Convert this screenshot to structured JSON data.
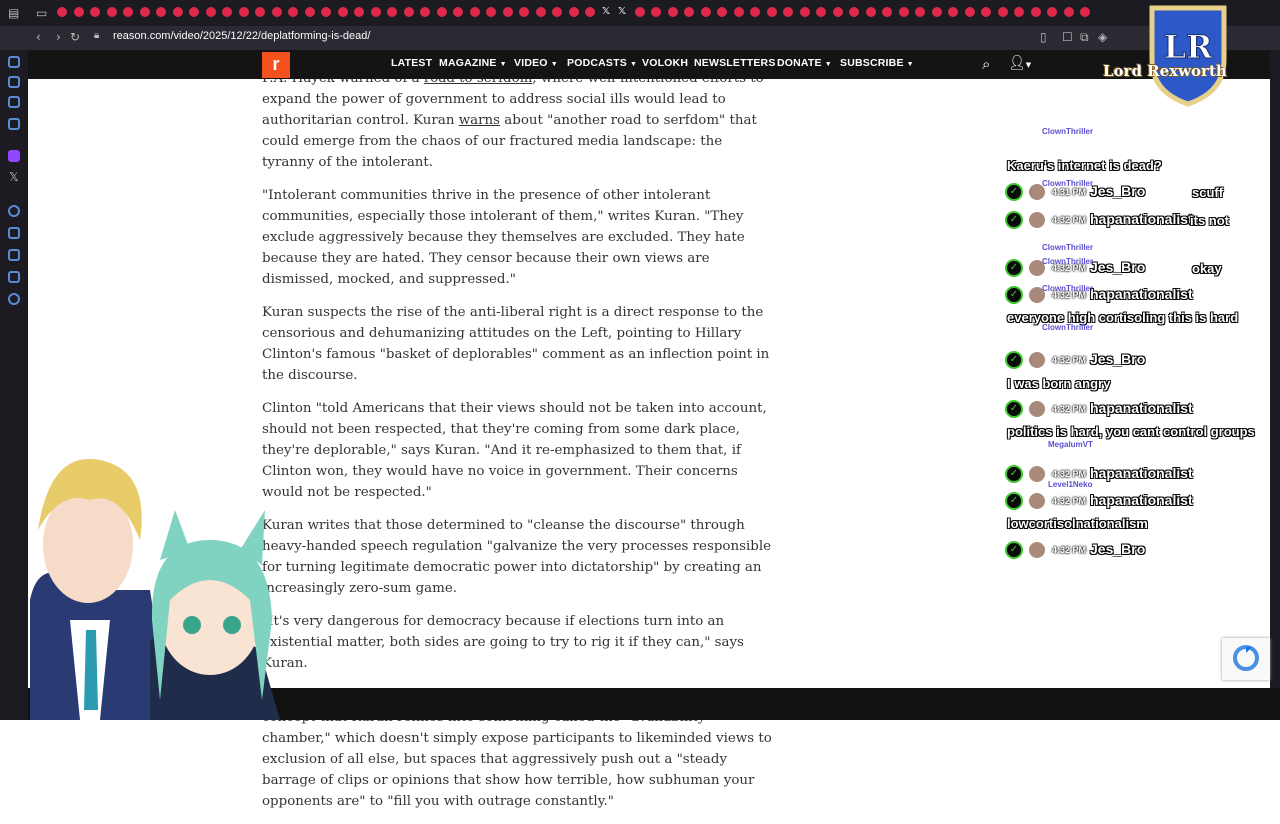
{
  "browser": {
    "url": "reason.com/video/2025/12/22/deplatforming-is-dead/"
  },
  "site": {
    "logo_letter": "r",
    "nav": [
      "LATEST",
      "MAGAZINE",
      "VIDEO",
      "PODCASTS",
      "VOLOKH",
      "NEWSLETTERS",
      "DONATE",
      "SUBSCRIBE"
    ]
  },
  "article": {
    "p0_pre": "F.A. Hayek warned of a ",
    "p0_link": "road to serfdom",
    "p0_mid": ", where well-intentioned efforts to expand the power of government to address social ills would lead to authoritarian control. Kuran ",
    "p0_link2": "warns",
    "p0_post": " about \"another road to serfdom\" that could emerge from the chaos of our fractured media landscape: the tyranny of the intolerant.",
    "p1": "\"Intolerant communities thrive in the presence of other intolerant communities, especially those intolerant of them,\" writes Kuran. \"They exclude aggressively because they themselves are excluded. They hate because they are hated. They censor because their own views are dismissed, mocked, and suppressed.\"",
    "p2": "Kuran suspects the rise of the anti-liberal right is a direct response to the censorious and dehumanizing attitudes on the Left, pointing to Hillary Clinton's famous \"basket of deplorables\" comment as an inflection point in the discourse.",
    "p3": "Clinton \"told Americans that their views should not be taken into account, should not been respected, that they're coming from some dark place, they're deplorable,\" says Kuran. \"And it re-emphasized to them that, if Clinton won, they would have no voice in government. Their concerns would not be respected.\"",
    "p4": "Kuran writes that those determined to \"cleanse the discourse\" through heavy-handed speech regulation \"galvanize the very processes responsible for turning legitimate democratic power into dictatorship\" by creating an increasingly zero-sum game.",
    "p5": "\"It's very dangerous for democracy because if elections turn into an existential matter, both sides are going to try to rig it if they can,\" says Kuran.",
    "p6": "The intolerant thrive in today's digital \"echo chambers,\" a well-worn concept that Kuran refines into something called the \"availability chamber,\" which doesn't simply expose participants to likeminded views to exclusion of all else, but spaces that aggressively push out a \"steady barrage of clips or opinions that show how terrible, how subhuman your opponents are\" to \"fill you with outrage constantly.\""
  },
  "overlay": {
    "streamer_name": "Lord Rexworth",
    "crest_letters": "LR",
    "chat": [
      {
        "type": "text",
        "text": "Kaeru's internet is dead?"
      },
      {
        "type": "msg",
        "time": "4:31 PM",
        "user": "Jes_Bro",
        "text": "scuff"
      },
      {
        "type": "msg",
        "time": "4:32 PM",
        "user": "hapanationalist",
        "text": "its not"
      },
      {
        "type": "msg",
        "time": "4:32 PM",
        "user": "Jes_Bro",
        "text": "okay"
      },
      {
        "type": "msg",
        "time": "4:32 PM",
        "user": "hapanationalist",
        "text": "everyone high cortisoling this is hard"
      },
      {
        "type": "msg",
        "time": "4:32 PM",
        "user": "Jes_Bro",
        "text": "I was born angry"
      },
      {
        "type": "msg",
        "time": "4:32 PM",
        "user": "hapanationalist",
        "text": "politics is hard, you cant control groups"
      },
      {
        "type": "msg",
        "time": "4:32 PM",
        "user": "hapanationalist",
        "text": ""
      },
      {
        "type": "msg",
        "time": "4:32 PM",
        "user": "hapanationalist",
        "text": "lowcortisolnationalism"
      },
      {
        "type": "msg",
        "time": "4:32 PM",
        "user": "Jes_Bro",
        "text": ""
      }
    ],
    "ghost_names": [
      "ClownThriller",
      "ClownThriller",
      "ClownThriller",
      "ClownThriller",
      "ClownThriller",
      "ClownThriller",
      "MegalumVT",
      "Level1Neko"
    ]
  },
  "colors": {
    "accent": "#f4511e",
    "nav_bg": "#141414",
    "chat_green": "#3fc72f"
  }
}
